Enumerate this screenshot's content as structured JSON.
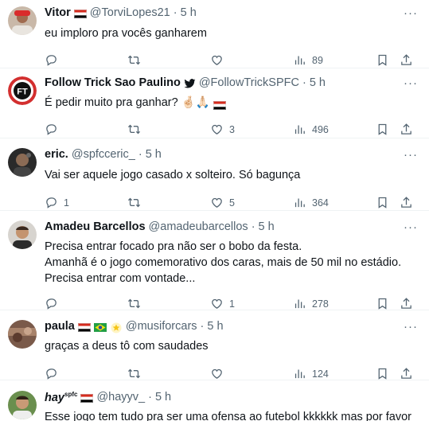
{
  "tweets": [
    {
      "name": "Vitor",
      "handle": "@TorviLopes21",
      "time": "5 h",
      "text": "eu imploro pra vocês ganharem",
      "replies": "",
      "retweets": "",
      "likes": "",
      "views": "89"
    },
    {
      "name": "Follow Trick Sao Paulino",
      "handle": "@FollowTrickSPFC",
      "time": "5 h",
      "text": "É pedir muito pra ganhar? 🤞🏻🙏🏻",
      "replies": "",
      "retweets": "",
      "likes": "3",
      "views": "496"
    },
    {
      "name": "eric.",
      "handle": "@spfcceric_",
      "time": "5 h",
      "text": "Vai ser aquele jogo casado x solteiro. Só bagunça",
      "replies": "1",
      "retweets": "",
      "likes": "5",
      "views": "364"
    },
    {
      "name": "Amadeu Barcellos",
      "handle": "@amadeubarcellos",
      "time": "5 h",
      "text_lines": [
        "Precisa entrar focado pra não ser o bobo da festa.",
        "Amanhã é o jogo comemorativo dos caras, mais de 50 mil no estádio.",
        "Precisa entrar com vontade..."
      ],
      "replies": "",
      "retweets": "",
      "likes": "1",
      "views": "278"
    },
    {
      "name": "paula",
      "handle": "@musiforcars",
      "time": "5 h",
      "text": "graças a deus tô com saudades",
      "replies": "",
      "retweets": "",
      "likes": "",
      "views": "124"
    },
    {
      "name": "hay",
      "name_sup": "spfc",
      "handle": "@hayyv_",
      "time": "5 h",
      "text": "Esse jogo tem tudo pra ser uma ofensa ao futebol kkkkkk mas por favor"
    }
  ],
  "more_glyph": "···",
  "dot": "·",
  "icons": [
    "reply-icon",
    "retweet-icon",
    "like-icon",
    "views-icon",
    "bookmark-icon",
    "share-icon",
    "more-icon",
    "verified-icon",
    "flag-icon"
  ]
}
